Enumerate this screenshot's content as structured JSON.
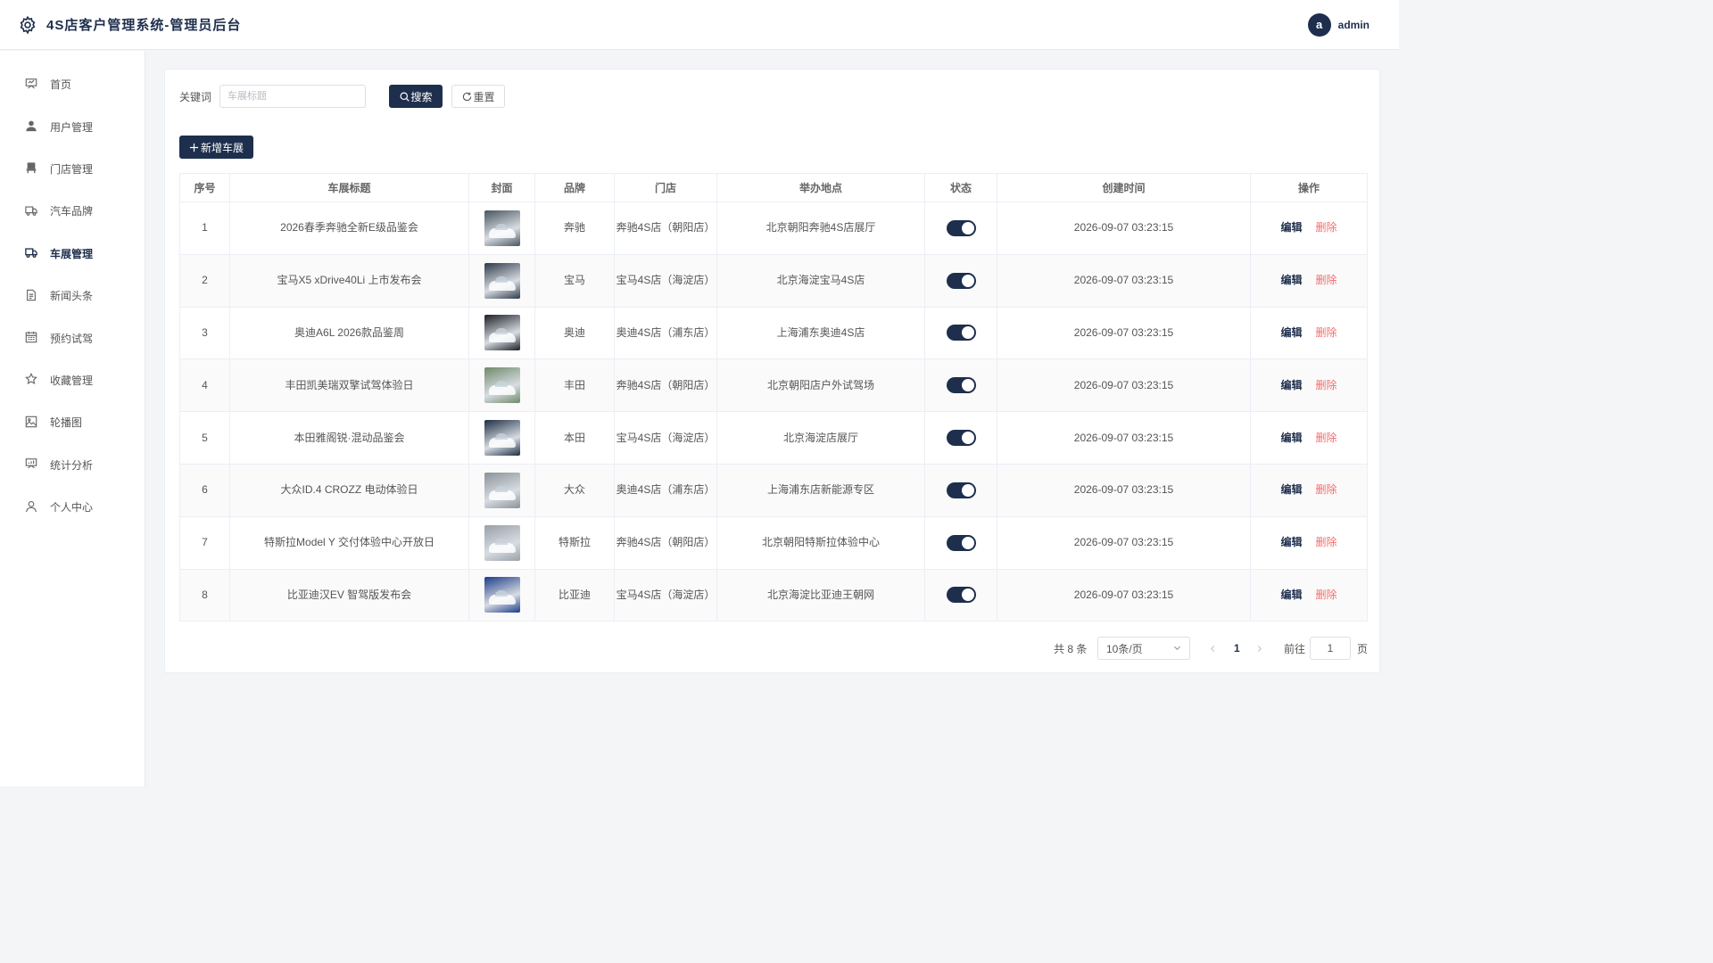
{
  "header": {
    "title": "4S店客户管理系统-管理员后台",
    "avatar_letter": "a",
    "username": "admin"
  },
  "sidebar": {
    "items": [
      {
        "label": "首页",
        "icon": "presentation-board-icon"
      },
      {
        "label": "用户管理",
        "icon": "user-icon"
      },
      {
        "label": "门店管理",
        "icon": "chair-icon"
      },
      {
        "label": "汽车品牌",
        "icon": "truck-icon"
      },
      {
        "label": "车展管理",
        "icon": "truck-icon",
        "active": true
      },
      {
        "label": "新闻头条",
        "icon": "document-icon"
      },
      {
        "label": "预约试驾",
        "icon": "calendar-icon"
      },
      {
        "label": "收藏管理",
        "icon": "star-icon"
      },
      {
        "label": "轮播图",
        "icon": "picture-icon"
      },
      {
        "label": "统计分析",
        "icon": "data-board-icon"
      },
      {
        "label": "个人中心",
        "icon": "avatar-outline-icon"
      }
    ]
  },
  "search": {
    "label": "关键词",
    "placeholder": "车展标题",
    "value": "",
    "search_label": "搜索",
    "reset_label": "重置"
  },
  "toolbar": {
    "add_label": "新增车展"
  },
  "table": {
    "columns": [
      "序号",
      "车展标题",
      "封面",
      "品牌",
      "门店",
      "举办地点",
      "状态",
      "创建时间",
      "操作"
    ],
    "edit_label": "编辑",
    "delete_label": "删除",
    "rows": [
      {
        "no": "1",
        "title": "2026春季奔驰全新E级品鉴会",
        "brand": "奔驰",
        "store": "奔驰4S店（朝阳店）",
        "location": "北京朝阳奔驰4S店展厅",
        "status_on": true,
        "created": "2026-09-07 03:23:15",
        "cover_color": "#4a5560"
      },
      {
        "no": "2",
        "title": "宝马X5 xDrive40Li 上市发布会",
        "brand": "宝马",
        "store": "宝马4S店（海淀店）",
        "location": "北京海淀宝马4S店",
        "status_on": true,
        "created": "2026-09-07 03:23:15",
        "cover_color": "#2e3a4a"
      },
      {
        "no": "3",
        "title": "奥迪A6L 2026款品鉴周",
        "brand": "奥迪",
        "store": "奥迪4S店（浦东店）",
        "location": "上海浦东奥迪4S店",
        "status_on": true,
        "created": "2026-09-07 03:23:15",
        "cover_color": "#1c1f26"
      },
      {
        "no": "4",
        "title": "丰田凯美瑞双擎试驾体验日",
        "brand": "丰田",
        "store": "奔驰4S店（朝阳店）",
        "location": "北京朝阳店户外试驾场",
        "status_on": true,
        "created": "2026-09-07 03:23:15",
        "cover_color": "#6f8a6a"
      },
      {
        "no": "5",
        "title": "本田雅阁锐·混动品鉴会",
        "brand": "本田",
        "store": "宝马4S店（海淀店）",
        "location": "北京海淀店展厅",
        "status_on": true,
        "created": "2026-09-07 03:23:15",
        "cover_color": "#1f2e45"
      },
      {
        "no": "6",
        "title": "大众ID.4 CROZZ 电动体验日",
        "brand": "大众",
        "store": "奥迪4S店（浦东店）",
        "location": "上海浦东店新能源专区",
        "status_on": true,
        "created": "2026-09-07 03:23:15",
        "cover_color": "#8a9298"
      },
      {
        "no": "7",
        "title": "特斯拉Model Y 交付体验中心开放日",
        "brand": "特斯拉",
        "store": "奔驰4S店（朝阳店）",
        "location": "北京朝阳特斯拉体验中心",
        "status_on": true,
        "created": "2026-09-07 03:23:15",
        "cover_color": "#9aa0a8"
      },
      {
        "no": "8",
        "title": "比亚迪汉EV 智驾版发布会",
        "brand": "比亚迪",
        "store": "宝马4S店（海淀店）",
        "location": "北京海淀比亚迪王朝网",
        "status_on": true,
        "created": "2026-09-07 03:23:15",
        "cover_color": "#1d3c8a"
      }
    ]
  },
  "pagination": {
    "total_label": "共 8 条",
    "page_size": "10条/页",
    "current_page": "1",
    "goto_label": "前往",
    "goto_value": "1",
    "page_unit": "页"
  }
}
